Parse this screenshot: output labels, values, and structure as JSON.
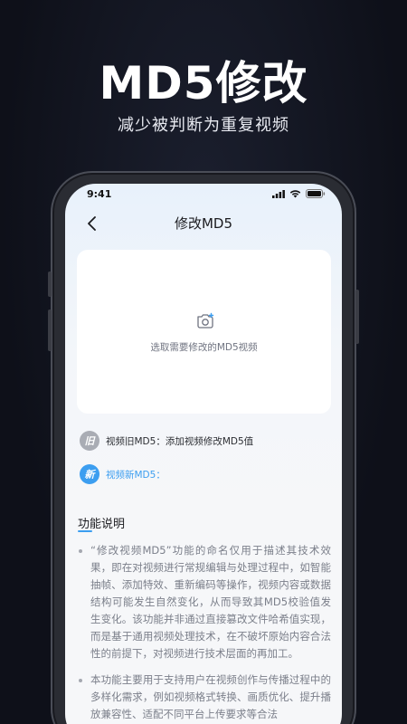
{
  "hero": {
    "title": "MD5修改",
    "subtitle": "减少被判断为重复视频"
  },
  "status_bar": {
    "time": "9:41",
    "icons": [
      "signal-icon",
      "wifi-icon",
      "battery-icon"
    ]
  },
  "nav": {
    "back_icon": "chevron-left-icon",
    "title": "修改MD5"
  },
  "upload": {
    "icon": "camera-plus-icon",
    "hint": "选取需要修改的MD5视频"
  },
  "old_md5": {
    "badge": "旧",
    "text": "视频旧MD5：添加视频修改MD5值"
  },
  "new_md5": {
    "badge": "新",
    "text": "视频新MD5："
  },
  "description": {
    "title": "功能说明",
    "items": [
      "“修改视频MD5”功能的命名仅用于描述其技术效果，即在对视频进行常规编辑与处理过程中，如智能抽帧、添加特效、重新编码等操作，视频内容或数据结构可能发生自然变化，从而导致其MD5校验值发生变化。该功能并非通过直接篡改文件哈希值实现，而是基于通用视频处理技术，在不破坏原始内容合法性的前提下，对视频进行技术层面的再加工。",
      "本功能主要用于支持用户在视频创作与传播过程中的多样化需求，例如视频格式转换、画质优化、提升播放兼容性、适配不同平台上传要求等合法"
    ]
  },
  "colors": {
    "background": "#0e1019",
    "accent": "#3c9ef0",
    "badge_old": "#a9acb4"
  }
}
